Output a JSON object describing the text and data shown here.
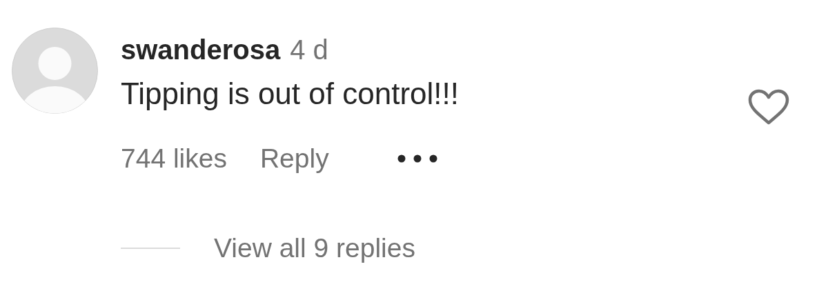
{
  "comment": {
    "username": "swanderosa",
    "time": "4 d",
    "text": "Tipping is out of control!!!",
    "liked": false,
    "likes": "744 likes",
    "reply": "Reply",
    "replies": "View all 9 replies"
  }
}
